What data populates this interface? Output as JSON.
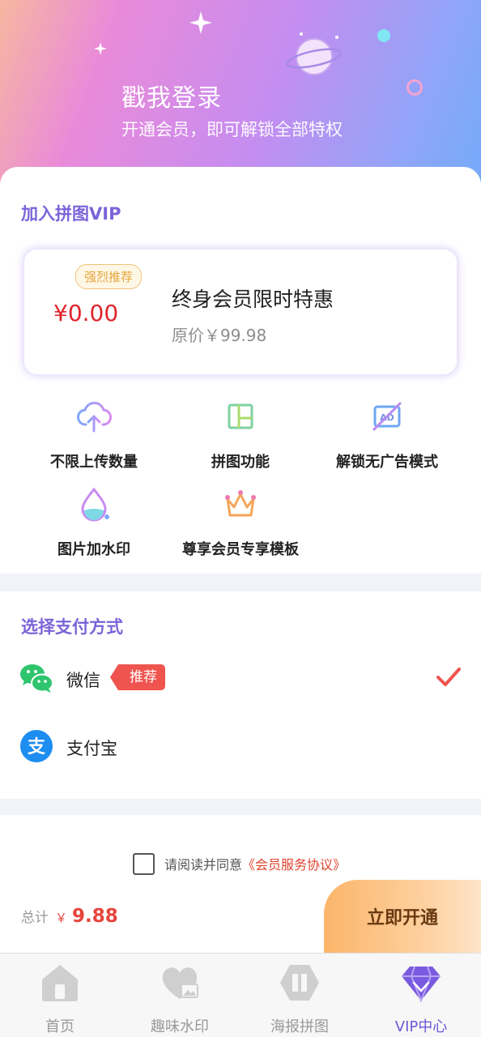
{
  "hero": {
    "title": "戳我登录",
    "subtitle": "开通会员，即可解锁全部特权"
  },
  "vip": {
    "section_title": "加入拼图VIP",
    "offer": {
      "badge": "强烈推荐",
      "price": "¥0.00",
      "name": "终身会员限时特惠",
      "original_price": "原价￥99.98"
    },
    "features": [
      {
        "label": "不限上传数量",
        "icon": "cloud-upload-icon"
      },
      {
        "label": "拼图功能",
        "icon": "collage-grid-icon"
      },
      {
        "label": "解锁无广告模式",
        "icon": "no-ads-icon"
      },
      {
        "label": "图片加水印",
        "icon": "watermark-drop-icon"
      },
      {
        "label": "尊享会员专享模板",
        "icon": "crown-icon"
      }
    ]
  },
  "payment": {
    "section_title": "选择支付方式",
    "methods": [
      {
        "name": "微信",
        "tag": "推荐",
        "icon": "wechat-icon",
        "selected": true
      },
      {
        "name": "支付宝",
        "icon": "alipay-icon",
        "selected": false
      }
    ]
  },
  "agreement": {
    "text": "请阅读并同意",
    "link": "《会员服务协议》",
    "checked": false
  },
  "checkout": {
    "total_label": "总计",
    "currency": "￥",
    "total": "9.88",
    "button": "立即开通"
  },
  "tabbar": {
    "tabs": [
      {
        "label": "首页",
        "icon": "home-icon"
      },
      {
        "label": "趣味水印",
        "icon": "heart-photo-icon"
      },
      {
        "label": "海报拼图",
        "icon": "poster-icon"
      },
      {
        "label": "VIP中心",
        "icon": "diamond-icon",
        "active": true
      }
    ]
  },
  "colors": {
    "accent": "#7b64d9",
    "price_red": "#e0242c",
    "tag_red": "#f0544f",
    "wechat_green": "#2fc56e",
    "alipay_blue": "#1d8df0"
  }
}
